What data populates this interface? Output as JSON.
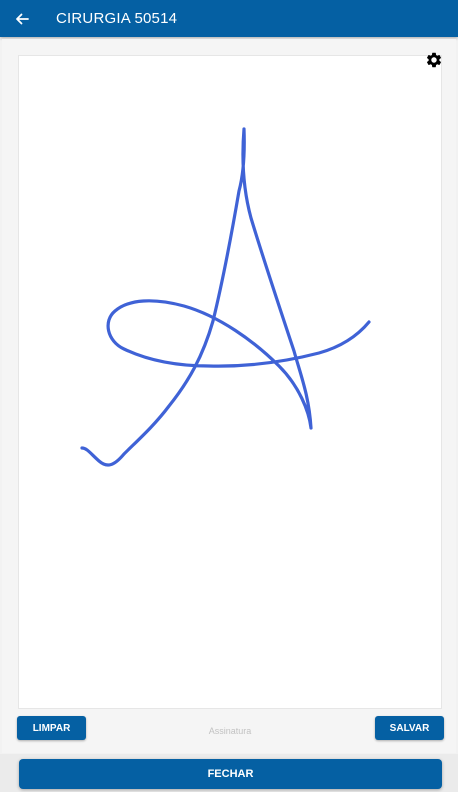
{
  "header": {
    "title": "CIRURGIA 50514",
    "back_icon": "arrow-left-icon",
    "background": "#0560a3"
  },
  "signature": {
    "caption": "Assinatura",
    "stroke_color": "#3f62d6",
    "settings_icon": "gear-icon"
  },
  "actions": {
    "clear_label": "LIMPAR",
    "save_label": "SALVAR",
    "close_label": "FECHAR"
  }
}
